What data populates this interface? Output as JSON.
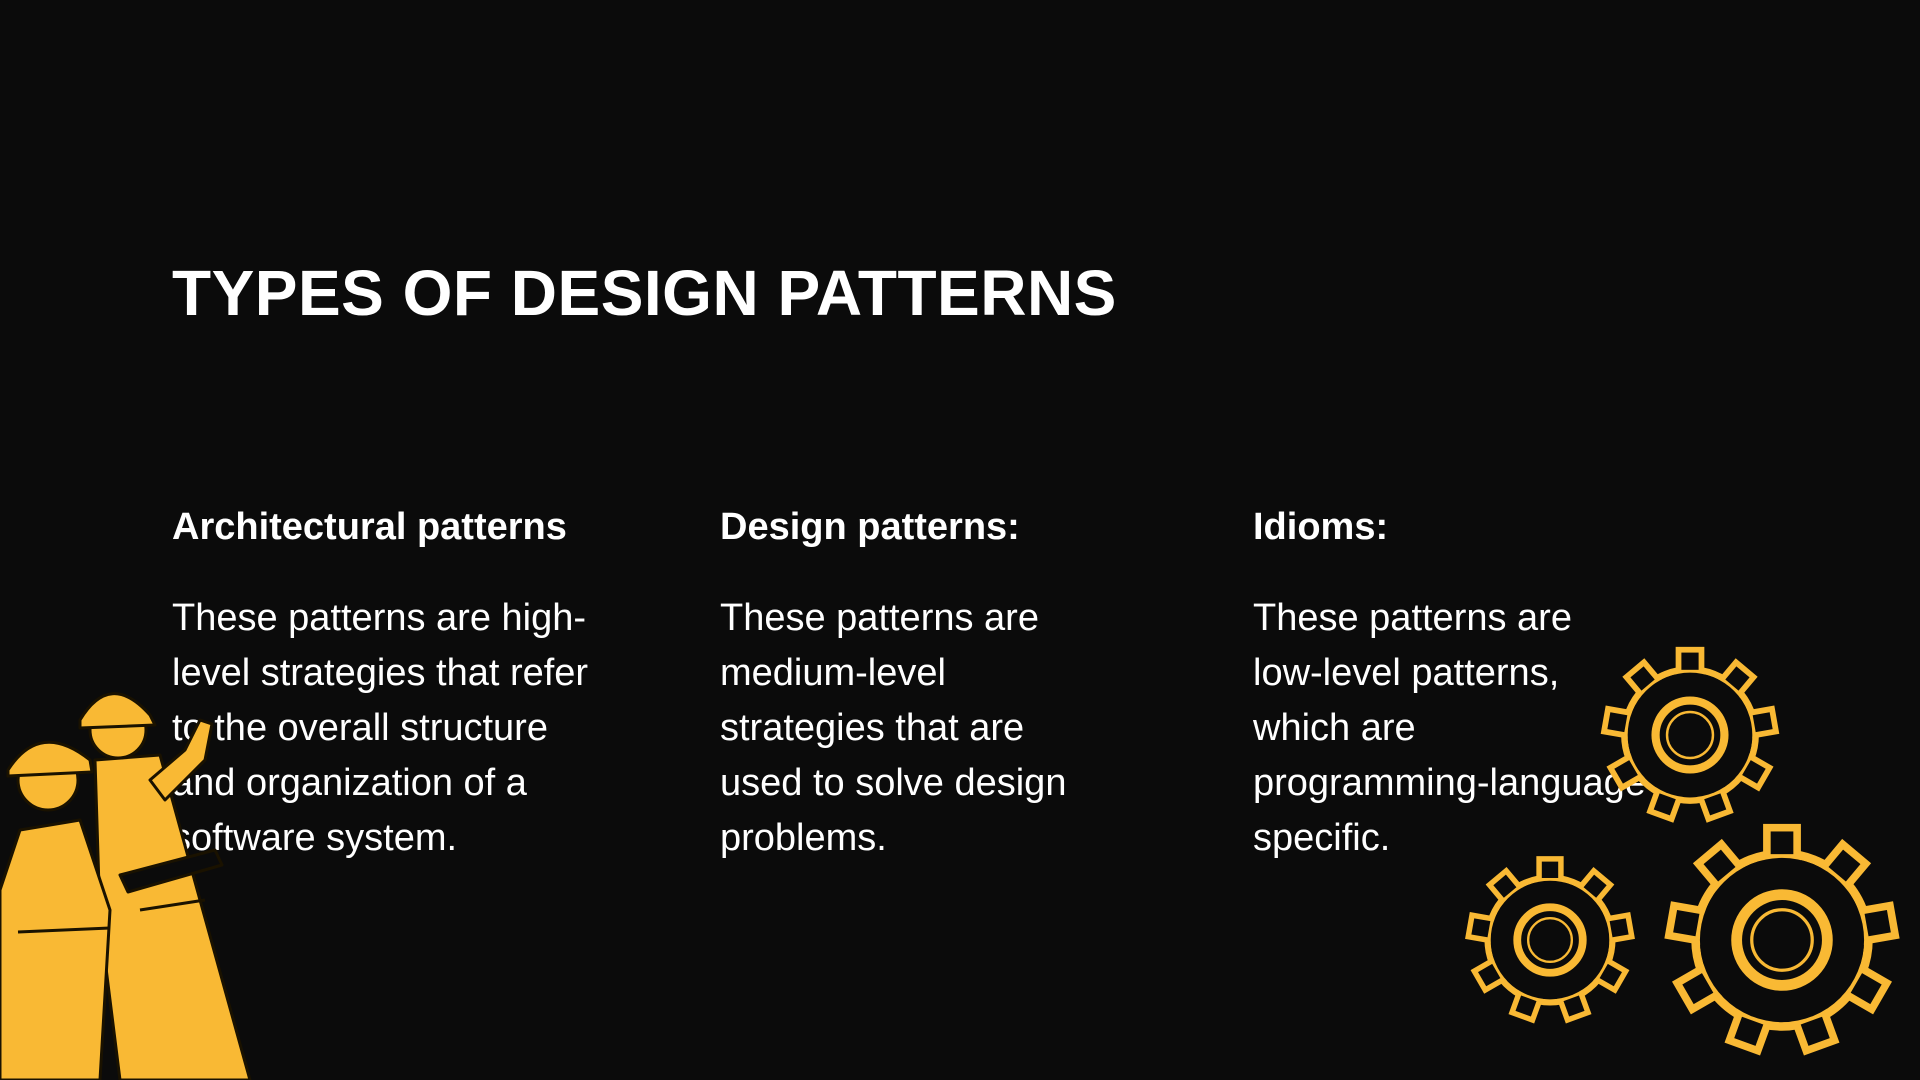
{
  "slide": {
    "title": "TYPES OF DESIGN PATTERNS",
    "columns": [
      {
        "heading": "Architectural patterns",
        "body": "These patterns are high-\nlevel strategies that refer\nto the overall structure\nand organization of a\nsoftware system."
      },
      {
        "heading": "Design patterns:",
        "body": "These patterns are\nmedium-level\nstrategies that are\nused to solve design\nproblems."
      },
      {
        "heading": "Idioms:",
        "body": "These patterns are\nlow-level patterns,\nwhich are\nprogramming-language\nspecific."
      }
    ]
  },
  "colors": {
    "background": "#0b0b0b",
    "text": "#ffffff",
    "accent": "#f9b934"
  },
  "icons": [
    "construction-workers-illustration",
    "gears-illustration"
  ]
}
